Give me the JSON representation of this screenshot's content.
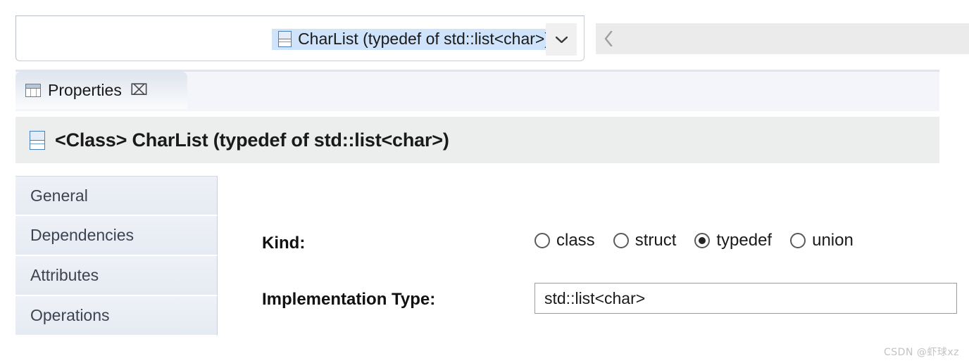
{
  "combo": {
    "icon": "class-typedef-icon",
    "value": "CharList (typedef of std::list<char>)",
    "dropdown_icon": "chevron-down-icon"
  },
  "toolbar": {
    "back_icon": "chevron-left-icon",
    "back_label": "<"
  },
  "tab": {
    "icon": "properties-grid-icon",
    "label": "Properties",
    "close_glyph": "⌧",
    "close_icon": "close-icon"
  },
  "header": {
    "icon": "class-typedef-icon",
    "title": "<Class> CharList (typedef of std::list<char>)"
  },
  "sidebar": {
    "items": [
      {
        "label": "General"
      },
      {
        "label": "Dependencies"
      },
      {
        "label": "Attributes"
      },
      {
        "label": "Operations"
      }
    ]
  },
  "form": {
    "kind": {
      "label": "Kind:",
      "selected": "typedef",
      "options": [
        {
          "label": "class",
          "selected": false
        },
        {
          "label": "struct",
          "selected": false
        },
        {
          "label": "typedef",
          "selected": true
        },
        {
          "label": "union",
          "selected": false
        }
      ]
    },
    "implementation_type": {
      "label": "Implementation Type:",
      "value": "std::list<char>",
      "placeholder": ""
    }
  },
  "watermark": {
    "text": "CSDN @虾球xz"
  },
  "colors": {
    "combo_highlight": "#cfe3fa",
    "title_band": "#eceded",
    "tab_strip": "#f4f5fa",
    "sidebar_item": "#eaeef5",
    "accent_blue": "#4a7ebb"
  }
}
